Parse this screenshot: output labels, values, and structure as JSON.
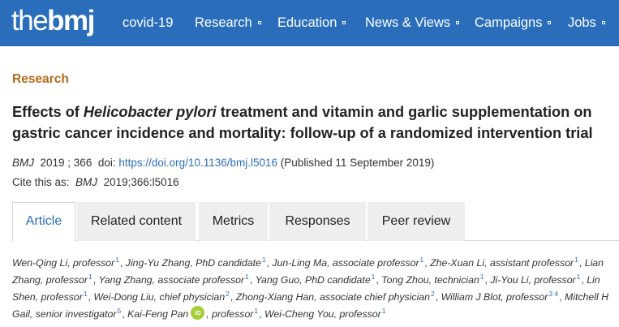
{
  "nav": {
    "logo_prefix": "the",
    "logo_brand": "bmj",
    "items": [
      {
        "label": "covid-19",
        "has_marker": false
      },
      {
        "label": "Research",
        "has_marker": true
      },
      {
        "label": "Education",
        "has_marker": true
      },
      {
        "label": "News & Views",
        "has_marker": true
      },
      {
        "label": "Campaigns",
        "has_marker": true
      },
      {
        "label": "Jobs",
        "has_marker": true
      }
    ]
  },
  "article": {
    "section": "Research",
    "title_part1": "Effects of ",
    "title_italic": "Helicobacter pylori",
    "title_part2": " treatment and vitamin and garlic supplementation on gastric cancer incidence and mortality: follow-up of a randomized intervention trial",
    "journal": "BMJ",
    "year_vol": "2019 ; 366",
    "doi_label": "doi:",
    "doi_link": "https://doi.org/10.1136/bmj.l5016",
    "published": "(Published 11 September 2019)",
    "cite_label": "Cite this as:",
    "cite_journal": "BMJ",
    "cite_ref": "2019;366:l5016"
  },
  "tabs": [
    {
      "label": "Article",
      "active": true
    },
    {
      "label": "Related content",
      "active": false
    },
    {
      "label": "Metrics",
      "active": false
    },
    {
      "label": "Responses",
      "active": false
    },
    {
      "label": "Peer review",
      "active": false
    }
  ],
  "authors": [
    {
      "name": "Wen-Qing Li, professor",
      "aff": "1"
    },
    {
      "name": "Jing-Yu Zhang, PhD candidate",
      "aff": "1"
    },
    {
      "name": "Jun-Ling Ma, associate professor",
      "aff": "1"
    },
    {
      "name": "Zhe-Xuan Li, assistant professor",
      "aff": "1"
    },
    {
      "name": "Lian Zhang, professor",
      "aff": "1"
    },
    {
      "name": "Yang Zhang, associate professor",
      "aff": "1"
    },
    {
      "name": "Yang Guo, PhD candidate",
      "aff": "1"
    },
    {
      "name": "Tong Zhou, technician",
      "aff": "1"
    },
    {
      "name": "Ji-You Li, professor",
      "aff": "1"
    },
    {
      "name": "Lin Shen, professor",
      "aff": "1"
    },
    {
      "name": "Wei-Dong Liu, chief physician",
      "aff": "2"
    },
    {
      "name": "Zhong-Xiang Han, associate chief physician",
      "aff": "2"
    },
    {
      "name": "William J Blot, professor",
      "aff": "3 4"
    },
    {
      "name": "Mitchell H Gail, senior investigator",
      "aff": "5"
    },
    {
      "name": "Kai-Feng Pan",
      "aff": "",
      "orcid": true,
      "suffix": ", professor",
      "suffix_aff": "1"
    },
    {
      "name": "Wei-Cheng You, professor",
      "aff": "1"
    }
  ],
  "orcid_label": "iD",
  "colors": {
    "nav_bg": "#2a6ebb",
    "section_label": "#b56a1c",
    "link": "#2a6ebb",
    "orcid": "#a6ce39",
    "tab_bg": "#eeeeee"
  }
}
